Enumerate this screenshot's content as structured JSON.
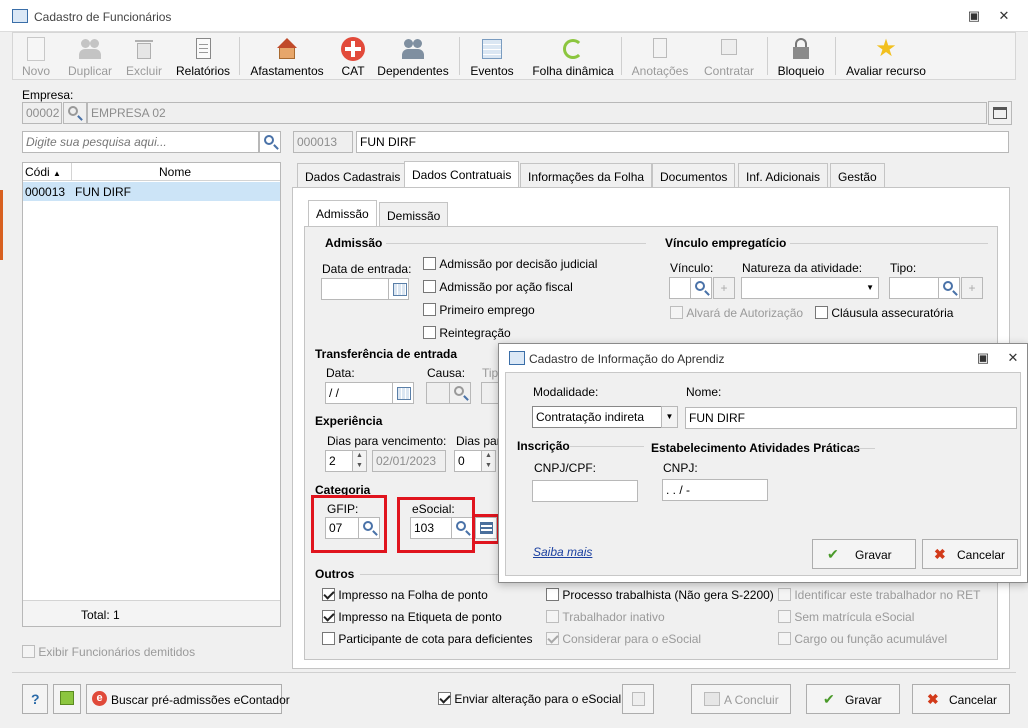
{
  "window": {
    "title": "Cadastro de Funcionários"
  },
  "toolbar": {
    "items": [
      {
        "label": "Novo",
        "enabled": false
      },
      {
        "label": "Duplicar",
        "enabled": false
      },
      {
        "label": "Excluir",
        "enabled": false
      },
      {
        "label": "Relatórios",
        "enabled": true
      },
      {
        "label": "Afastamentos",
        "enabled": true
      },
      {
        "label": "CAT",
        "enabled": true
      },
      {
        "label": "Dependentes",
        "enabled": true
      },
      {
        "label": "Eventos",
        "enabled": true
      },
      {
        "label": "Folha dinâmica",
        "enabled": true
      },
      {
        "label": "Anotações",
        "enabled": false
      },
      {
        "label": "Contratar",
        "enabled": false
      },
      {
        "label": "Bloqueio",
        "enabled": true
      },
      {
        "label": "Avaliar recurso",
        "enabled": true
      }
    ]
  },
  "company": {
    "label": "Empresa:",
    "code": "00002",
    "name": "EMPRESA 02"
  },
  "search": {
    "placeholder": "Digite sua pesquisa aqui..."
  },
  "employee": {
    "code": "000013",
    "name": "FUN DIRF"
  },
  "grid": {
    "col_code": "Códi",
    "col_name": "Nome",
    "rows": [
      {
        "code": "000013",
        "name": "FUN DIRF"
      }
    ],
    "total": "Total: 1"
  },
  "show_dismissed": "Exibir Funcionários demitidos",
  "tabs": [
    "Dados Cadastrais",
    "Dados Contratuais",
    "Informações da Folha",
    "Documentos",
    "Inf. Adicionais",
    "Gestão"
  ],
  "subtabs": [
    "Admissão",
    "Demissão"
  ],
  "admissao": {
    "section": "Admissão",
    "date_label": "Data de entrada:",
    "checks": [
      "Admissão por decisão judicial",
      "Admissão por ação fiscal",
      "Primeiro emprego",
      "Reintegração"
    ]
  },
  "vinculo": {
    "section": "Vínculo empregatício",
    "vinculo_label": "Vínculo:",
    "natureza_label": "Natureza da atividade:",
    "tipo_label": "Tipo:",
    "alvara": "Alvará de Autorização",
    "clausula": "Cláusula assecuratória"
  },
  "transferencia": {
    "section": "Transferência de entrada",
    "data_label": "Data:",
    "data_value": " /  /",
    "causa_label": "Causa:",
    "tipo_label": "Tip"
  },
  "experiencia": {
    "section": "Experiência",
    "dias_label": "Dias para vencimento:",
    "dias_value": "2",
    "date_value": "02/01/2023",
    "dias2_label": "Dias par",
    "dias2_value": "0"
  },
  "categoria": {
    "section": "Categoria",
    "gfip_label": "GFIP:",
    "gfip_value": "07",
    "esocial_label": "eSocial:",
    "esocial_value": "103"
  },
  "outros": {
    "section": "Outros",
    "col1": [
      {
        "label": "Impresso na Folha de ponto",
        "checked": true
      },
      {
        "label": "Impresso na Etiqueta de ponto",
        "checked": true
      },
      {
        "label": "Participante de cota para deficientes",
        "checked": false
      }
    ],
    "col2": [
      {
        "label": "Processo trabalhista (Não gera S-2200)",
        "checked": false,
        "enabled": true
      },
      {
        "label": "Trabalhador inativo",
        "checked": false,
        "enabled": false
      },
      {
        "label": "Considerar para o eSocial",
        "checked": true,
        "enabled": false
      }
    ],
    "col3": [
      {
        "label": "Identificar este trabalhador no RET"
      },
      {
        "label": "Sem matrícula eSocial"
      },
      {
        "label": "Cargo ou função acumulável"
      }
    ]
  },
  "dialog": {
    "title": "Cadastro de Informação do Aprendiz",
    "modalidade_label": "Modalidade:",
    "modalidade_value": "Contratação indireta",
    "nome_label": "Nome:",
    "nome_value": "FUN DIRF",
    "inscricao": "Inscrição",
    "estab": "Estabelecimento Atividades Práticas",
    "cnpjcpf_label": "CNPJ/CPF:",
    "cnpj_label": "CNPJ:",
    "cnpj_value": " .  .  /   -",
    "saiba": "Saiba mais",
    "gravar": "Gravar",
    "cancelar": "Cancelar"
  },
  "bottom": {
    "buscar": "Buscar pré-admissões eContador",
    "enviar": "Enviar alteração para o eSocial",
    "concluir": "A Concluir",
    "gravar": "Gravar",
    "cancelar": "Cancelar",
    "help": "?"
  }
}
